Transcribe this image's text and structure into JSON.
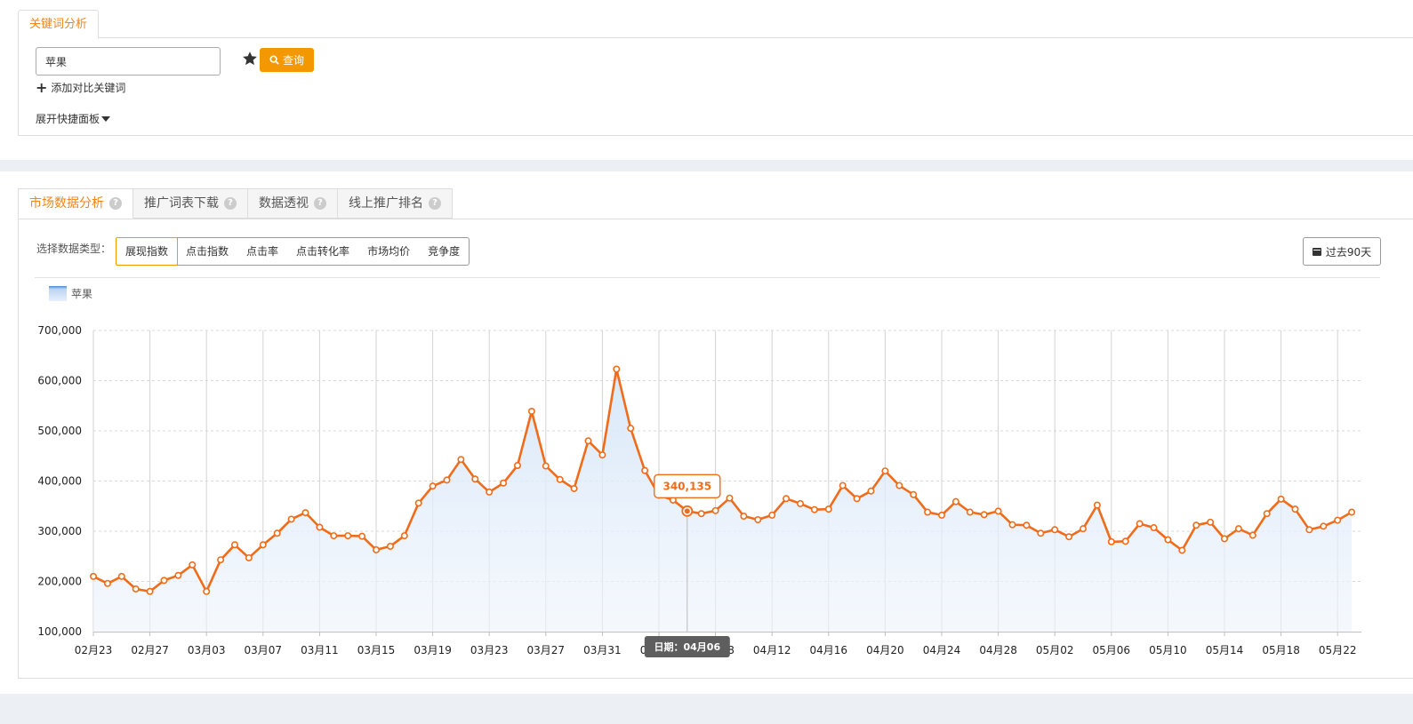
{
  "keyword_panel": {
    "tab_label": "关键词分析",
    "input_value": "苹果",
    "query_label": "查询",
    "add_compare_label": "添加对比关键词",
    "expand_label": "展开快捷面板"
  },
  "market_panel": {
    "tabs": [
      {
        "label": "市场数据分析",
        "active": true
      },
      {
        "label": "推广词表下载",
        "active": false
      },
      {
        "label": "数据透视",
        "active": false
      },
      {
        "label": "线上推广排名",
        "active": false
      }
    ],
    "type_label": "选择数据类型：",
    "data_types": [
      "展现指数",
      "点击指数",
      "点击率",
      "点击转化率",
      "市场均价",
      "竞争度"
    ],
    "active_type": "展现指数",
    "range_label": "过去90天"
  },
  "colors": {
    "accent": "#f08519",
    "line": "#ef6c1a",
    "area": "#dce9f8",
    "button": "#f39800"
  },
  "chart_data": {
    "type": "area",
    "legend": [
      "苹果"
    ],
    "series": [
      {
        "name": "苹果",
        "values": [
          210000,
          196000,
          210000,
          185000,
          180000,
          202000,
          212000,
          233000,
          180000,
          243000,
          273000,
          247000,
          273000,
          296000,
          324000,
          337000,
          308000,
          291000,
          291000,
          290000,
          263000,
          270000,
          291000,
          356000,
          390000,
          402000,
          443000,
          404000,
          378000,
          396000,
          431000,
          539000,
          430000,
          403000,
          385000,
          480000,
          452000,
          623000,
          505000,
          421000,
          372000,
          362000,
          340135,
          335000,
          341000,
          366000,
          330000,
          323000,
          332000,
          365000,
          355000,
          343000,
          344000,
          391000,
          365000,
          380000,
          420000,
          391000,
          373000,
          338000,
          332000,
          359000,
          338000,
          333000,
          340000,
          313000,
          312000,
          296000,
          303000,
          289000,
          305000,
          352000,
          279000,
          280000,
          315000,
          307000,
          283000,
          262000,
          312000,
          318000,
          285000,
          305000,
          292000,
          335000,
          364000,
          344000,
          303000,
          310000,
          322000,
          338000
        ]
      }
    ],
    "x_tick_labels": [
      "02月23",
      "02月27",
      "03月03",
      "03月07",
      "03月11",
      "03月15",
      "03月19",
      "03月23",
      "03月27",
      "03月31",
      "04月04",
      "04月08",
      "04月12",
      "04月16",
      "04月20",
      "04月24",
      "04月28",
      "05月02",
      "05月06",
      "05月10",
      "05月14",
      "05月18",
      "05月22"
    ],
    "y_ticks": [
      100000,
      200000,
      300000,
      400000,
      500000,
      600000,
      700000
    ],
    "y_tick_labels": [
      "100,000",
      "200,000",
      "300,000",
      "400,000",
      "500,000",
      "600,000",
      "700,000"
    ],
    "ylim": [
      100000,
      700000
    ],
    "grid": true,
    "tooltip": {
      "value": "340,135",
      "date_prefix": "日期：",
      "date": "04月06"
    }
  }
}
